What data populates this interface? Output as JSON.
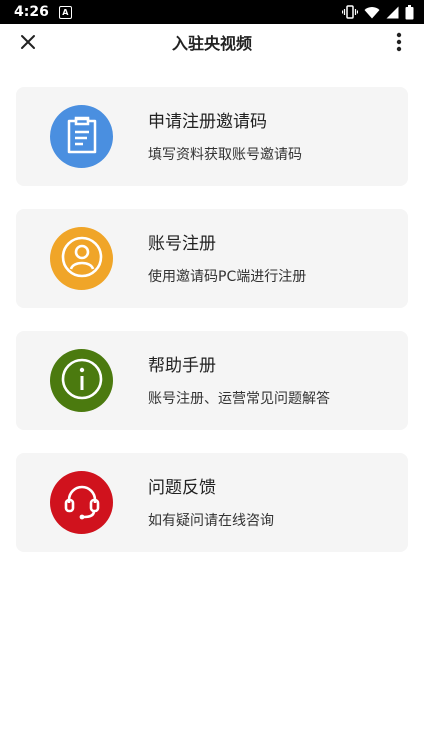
{
  "status_bar": {
    "time": "4:26",
    "notification_glyph": "A",
    "icons": [
      "vibrate-icon",
      "wifi-icon",
      "signal-icon",
      "battery-icon"
    ]
  },
  "app_bar": {
    "title": "入驻央视频",
    "close_icon": "close-icon",
    "more_icon": "more-vertical-icon"
  },
  "cards": [
    {
      "title": "申请注册邀请码",
      "desc": "填写资料获取账号邀请码",
      "icon": "clipboard-icon",
      "color": "#4a8fe0"
    },
    {
      "title": "账号注册",
      "desc": "使用邀请码PC端进行注册",
      "icon": "user-icon",
      "color": "#f0a528"
    },
    {
      "title": "帮助手册",
      "desc": "账号注册、运营常见问题解答",
      "icon": "info-icon",
      "color": "#4b7a0f"
    },
    {
      "title": "问题反馈",
      "desc": "如有疑问请在线咨询",
      "icon": "headset-icon",
      "color": "#d0121d"
    }
  ]
}
